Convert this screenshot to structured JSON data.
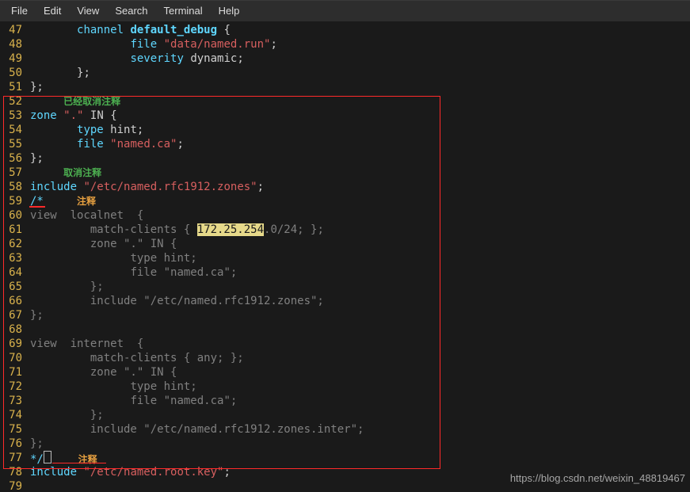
{
  "menubar": {
    "items": [
      "File",
      "Edit",
      "View",
      "Search",
      "Terminal",
      "Help"
    ]
  },
  "watermark": "https://blog.csdn.net/weixin_48819467",
  "annot": {
    "a1": "已经取消注释",
    "a2": "取消注释",
    "a3": "注释",
    "a4": "注释"
  },
  "ln": {
    "47": "47",
    "48": "48",
    "49": "49",
    "50": "50",
    "51": "51",
    "52": "52",
    "53": "53",
    "54": "54",
    "55": "55",
    "56": "56",
    "57": "57",
    "58": "58",
    "59": "59",
    "60": "60",
    "61": "61",
    "62": "62",
    "63": "63",
    "64": "64",
    "65": "65",
    "66": "66",
    "67": "67",
    "68": "68",
    "69": "69",
    "70": "70",
    "71": "71",
    "72": "72",
    "73": "73",
    "74": "74",
    "75": "75",
    "76": "76",
    "77": "77",
    "78": "78",
    "79": "79"
  },
  "t": {
    "47": {
      "sp": "       ",
      "kw": "channel",
      "sp2": " ",
      "id": "default_debug",
      "sp3": " ",
      "br": "{"
    },
    "48": {
      "sp": "               ",
      "kw": "file",
      "sp2": " ",
      "str": "\"data/named.run\"",
      "sc": ";"
    },
    "49": {
      "sp": "               ",
      "kw": "severity",
      "sp2": " ",
      "id": "dynamic",
      "sc": ";"
    },
    "50": {
      "sp": "       ",
      "br": "};"
    },
    "51": {
      "br": "};"
    },
    "53": {
      "kw": "zone",
      "sp": " ",
      "str": "\".\"",
      "sp2": " ",
      "in": "IN ",
      "br": "{"
    },
    "54": {
      "sp": "       ",
      "kw": "type",
      "sp2": " ",
      "id": "hint",
      "sc": ";"
    },
    "55": {
      "sp": "       ",
      "kw": "file",
      "sp2": " ",
      "str": "\"named.ca\"",
      "sc": ";"
    },
    "56": {
      "br": "};"
    },
    "58": {
      "kw": "include",
      "sp": " ",
      "str": "\"/etc/named.rfc1912.zones\"",
      "sc": ";"
    },
    "59": {
      "cmt": "/*"
    },
    "60": {
      "txt": "view  localnet  {"
    },
    "61": {
      "sp": "         ",
      "a": "match-clients { ",
      "hi": "172.25.254",
      "b": ".0/24; };"
    },
    "62": {
      "sp": "         ",
      "txt": "zone \".\" IN {"
    },
    "63": {
      "sp": "               ",
      "txt": "type hint;"
    },
    "64": {
      "sp": "               ",
      "txt": "file \"named.ca\";"
    },
    "65": {
      "sp": "         ",
      "txt": "};"
    },
    "66": {
      "sp": "         ",
      "txt": "include \"/etc/named.rfc1912.zones\";"
    },
    "67": {
      "txt": "};"
    },
    "68": {
      "txt": ""
    },
    "69": {
      "txt": "view  internet  {"
    },
    "70": {
      "sp": "         ",
      "txt": "match-clients { any; };"
    },
    "71": {
      "sp": "         ",
      "txt": "zone \".\" IN {"
    },
    "72": {
      "sp": "               ",
      "txt": "type hint;"
    },
    "73": {
      "sp": "               ",
      "txt": "file \"named.ca\";"
    },
    "74": {
      "sp": "         ",
      "txt": "};"
    },
    "75": {
      "sp": "         ",
      "txt": "include \"/etc/named.rfc1912.zones.inter\";"
    },
    "76": {
      "txt": "};"
    },
    "77": {
      "cmt": "*/"
    },
    "78": {
      "kw": "include",
      "sp": " ",
      "str": "\"/etc/named.root.key\"",
      "sc": ";"
    }
  }
}
